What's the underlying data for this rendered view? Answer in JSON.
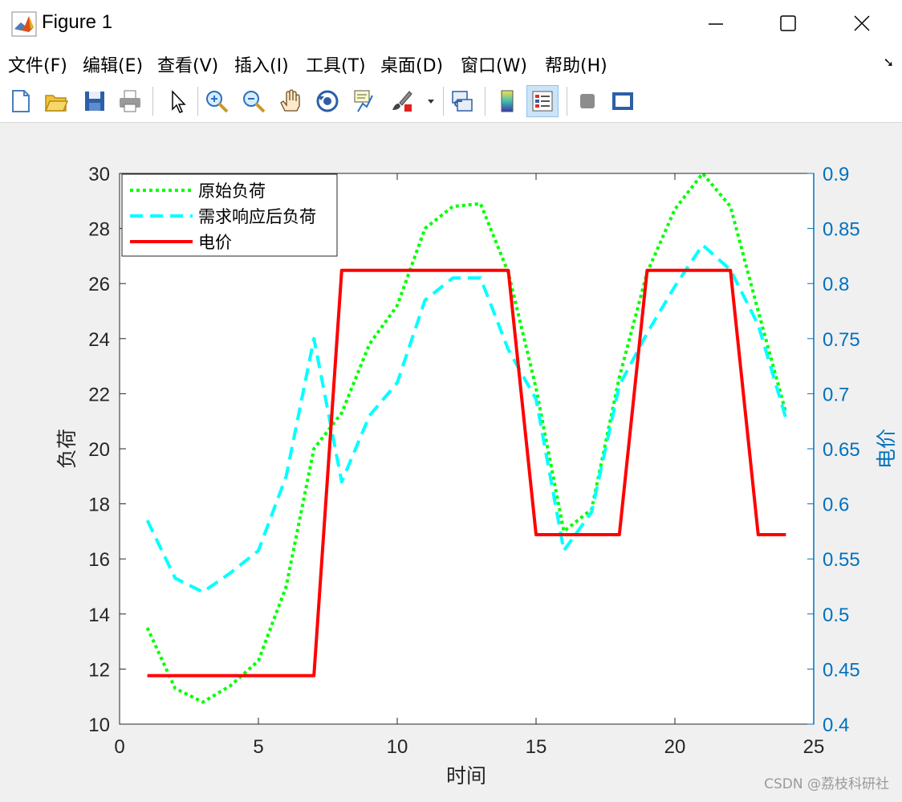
{
  "window": {
    "title": "Figure 1",
    "menu": [
      "文件(F)",
      "编辑(E)",
      "查看(V)",
      "插入(I)",
      "工具(T)",
      "桌面(D)",
      "窗口(W)",
      "帮助(H)"
    ]
  },
  "toolbar": {
    "icons": [
      "new-figure-icon",
      "open-file-icon",
      "save-icon",
      "print-icon",
      "select-arrow-icon",
      "zoom-in-icon",
      "zoom-out-icon",
      "pan-hand-icon",
      "rotate-3d-icon",
      "data-cursor-icon",
      "brush-icon",
      "link-plot-icon",
      "colorbar-icon",
      "legend-icon",
      "hide-plot-tools-icon",
      "show-plot-tools-icon"
    ]
  },
  "watermark": "CSDN @荔枝科研社",
  "chart_data": {
    "type": "line",
    "xlabel": "时间",
    "ylabel_left": "负荷",
    "ylabel_right": "电价",
    "xlim": [
      0,
      25
    ],
    "ylim_left": [
      10,
      30
    ],
    "ylim_right": [
      0.4,
      0.9
    ],
    "xticks": [
      "0",
      "5",
      "10",
      "15",
      "20",
      "25"
    ],
    "yticks_left": [
      "10",
      "12",
      "14",
      "16",
      "18",
      "20",
      "22",
      "24",
      "26",
      "28",
      "30"
    ],
    "yticks_right": [
      "0.4",
      "0.45",
      "0.5",
      "0.55",
      "0.6",
      "0.65",
      "0.7",
      "0.75",
      "0.8",
      "0.85",
      "0.9"
    ],
    "legend_position": "top-left",
    "x": [
      1,
      2,
      3,
      4,
      5,
      6,
      7,
      8,
      9,
      10,
      11,
      12,
      13,
      14,
      15,
      16,
      17,
      18,
      19,
      20,
      21,
      22,
      23,
      24
    ],
    "series": [
      {
        "name": "原始负荷",
        "axis": "left",
        "style": "dotted",
        "color": "#00ff00",
        "values": [
          13.5,
          11.3,
          10.8,
          11.4,
          12.3,
          15.0,
          20.0,
          21.3,
          23.8,
          25.2,
          28.0,
          28.8,
          28.9,
          26.4,
          22.2,
          17.0,
          17.8,
          22.6,
          26.4,
          28.7,
          30.0,
          28.8,
          25.0,
          21.3
        ]
      },
      {
        "name": "需求响应后负荷",
        "axis": "left",
        "style": "dashed",
        "color": "#00ffff",
        "values": [
          17.4,
          15.3,
          14.8,
          15.5,
          16.3,
          19.0,
          24.0,
          18.8,
          21.2,
          22.4,
          25.4,
          26.2,
          26.2,
          23.6,
          21.8,
          16.3,
          17.7,
          22.3,
          24.2,
          25.9,
          27.4,
          26.5,
          24.5,
          21.1
        ]
      },
      {
        "name": "电价",
        "axis": "right",
        "style": "solid",
        "color": "#ff0000",
        "values": [
          0.444,
          0.444,
          0.444,
          0.444,
          0.444,
          0.444,
          0.444,
          0.812,
          0.812,
          0.812,
          0.812,
          0.812,
          0.812,
          0.812,
          0.572,
          0.572,
          0.572,
          0.572,
          0.812,
          0.812,
          0.812,
          0.812,
          0.572,
          0.572
        ]
      }
    ],
    "right_axis_color": "#0072bd",
    "grid": false
  }
}
